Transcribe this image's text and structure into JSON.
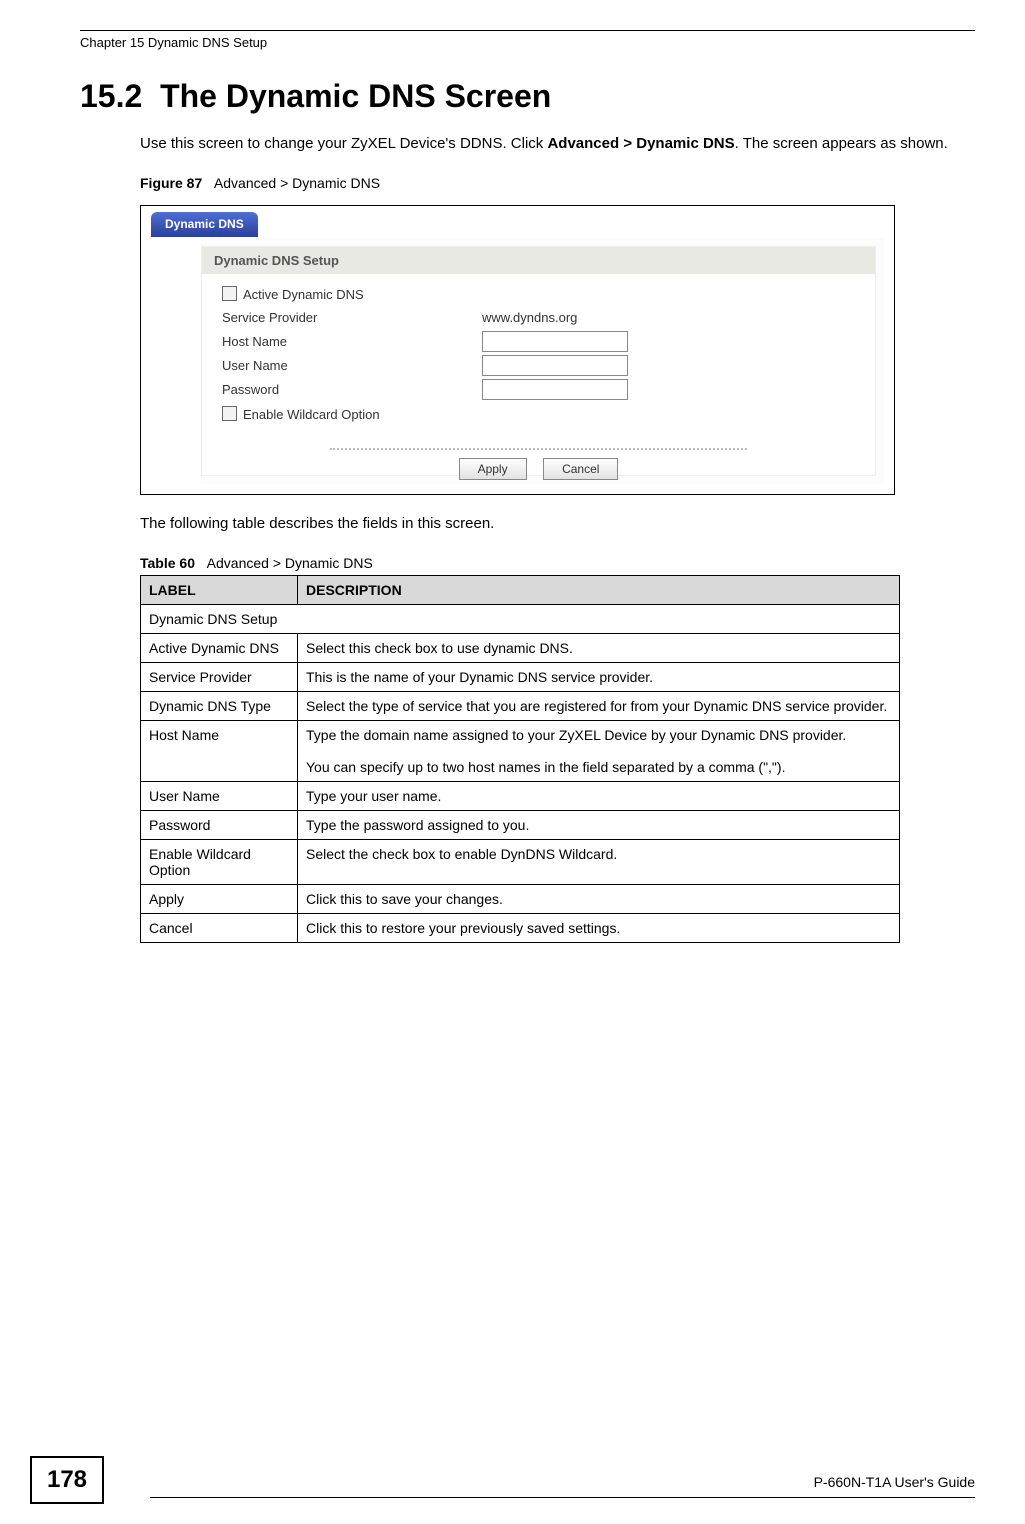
{
  "header": {
    "chapter_line": "Chapter 15 Dynamic DNS Setup"
  },
  "section": {
    "number": "15.2",
    "title": "The Dynamic DNS Screen",
    "intro_pre": "Use this screen to change your ZyXEL Device's DDNS. Click ",
    "intro_bold": "Advanced > Dynamic DNS",
    "intro_post": ". The screen appears as shown."
  },
  "figure": {
    "caption_prefix": "Figure 87",
    "caption_text": "Advanced > Dynamic DNS",
    "tab_label": "Dynamic DNS",
    "panel_title": "Dynamic DNS Setup",
    "rows": {
      "active_label": "Active Dynamic DNS",
      "service_provider_label": "Service Provider",
      "service_provider_value": "www.dyndns.org",
      "host_name_label": "Host Name",
      "user_name_label": "User Name",
      "password_label": "Password",
      "wildcard_label": "Enable Wildcard Option"
    },
    "buttons": {
      "apply": "Apply",
      "cancel": "Cancel"
    }
  },
  "table_intro": "The following table describes the fields in this screen.",
  "table": {
    "caption_prefix": "Table 60",
    "caption_text": "Advanced > Dynamic DNS",
    "head_label": "LABEL",
    "head_desc": "DESCRIPTION",
    "rows": [
      {
        "label": "Dynamic DNS Setup",
        "desc": "",
        "section": true
      },
      {
        "label": "Active Dynamic DNS",
        "desc": "Select this check box to use dynamic DNS."
      },
      {
        "label": "Service Provider",
        "desc": "This is the name of your Dynamic DNS service provider."
      },
      {
        "label": "Dynamic DNS Type",
        "desc": "Select the type of service that you are registered for from your Dynamic DNS service provider."
      },
      {
        "label": "Host Name",
        "desc": "Type the domain name assigned to your ZyXEL Device by your Dynamic DNS provider.\n\nYou can specify up to two host names in the field separated by a comma (\",\")."
      },
      {
        "label": "User Name",
        "desc": "Type your user name."
      },
      {
        "label": "Password",
        "desc": "Type the password assigned to you."
      },
      {
        "label": "Enable Wildcard Option",
        "desc": "Select the check box to enable DynDNS Wildcard."
      },
      {
        "label": "Apply",
        "desc": "Click this to save your changes."
      },
      {
        "label": "Cancel",
        "desc": "Click this to restore your previously saved settings."
      }
    ]
  },
  "footer": {
    "page_number": "178",
    "guide": "P-660N-T1A User's Guide"
  }
}
